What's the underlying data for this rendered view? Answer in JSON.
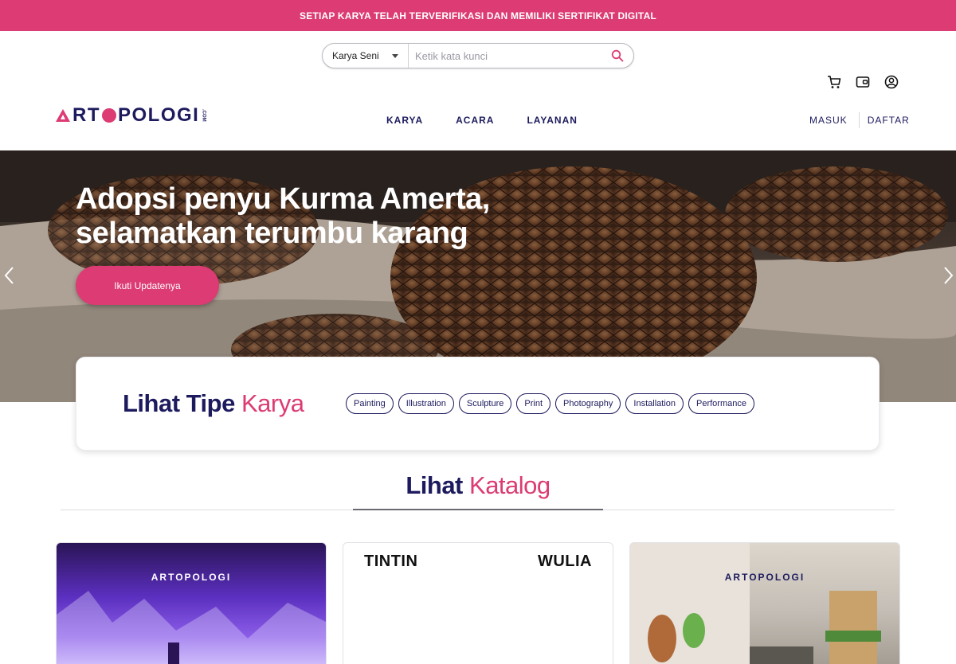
{
  "announcement": "SETIAP KARYA TELAH TERVERIFIKASI DAN MEMILIKI SERTIFIKAT DIGITAL",
  "search": {
    "category": "Karya Seni",
    "placeholder": "Ketik kata kunci",
    "icon": "search-icon"
  },
  "header_icons": [
    "cart-icon",
    "wallet-icon",
    "account-icon"
  ],
  "logo": {
    "text_a": "RT",
    "text_b": "POLOGI",
    "suffix": ".COM"
  },
  "nav": [
    "KARYA",
    "ACARA",
    "LAYANAN"
  ],
  "auth": {
    "login": "MASUK",
    "register": "DAFTAR"
  },
  "hero": {
    "title_line1": "Adopsi penyu Kurma Amerta,",
    "title_line2": "selamatkan terumbu karang",
    "cta": "Ikuti Updatenya"
  },
  "types": {
    "title_dark": "Lihat Tipe",
    "title_pink": "Karya",
    "chips": [
      "Painting",
      "Illustration",
      "Sculpture",
      "Print",
      "Photography",
      "Installation",
      "Performance"
    ]
  },
  "catalog": {
    "title_dark": "Lihat",
    "title_pink": "Katalog"
  },
  "cards": {
    "card1_logo": "ARTOPOLOGI",
    "card2_left": "TINTIN",
    "card2_right": "WULIA",
    "card3_logo": "ARTOPOLOGI"
  },
  "colors": {
    "brand_pink": "#dc3b73",
    "brand_navy": "#1d1b5e"
  }
}
